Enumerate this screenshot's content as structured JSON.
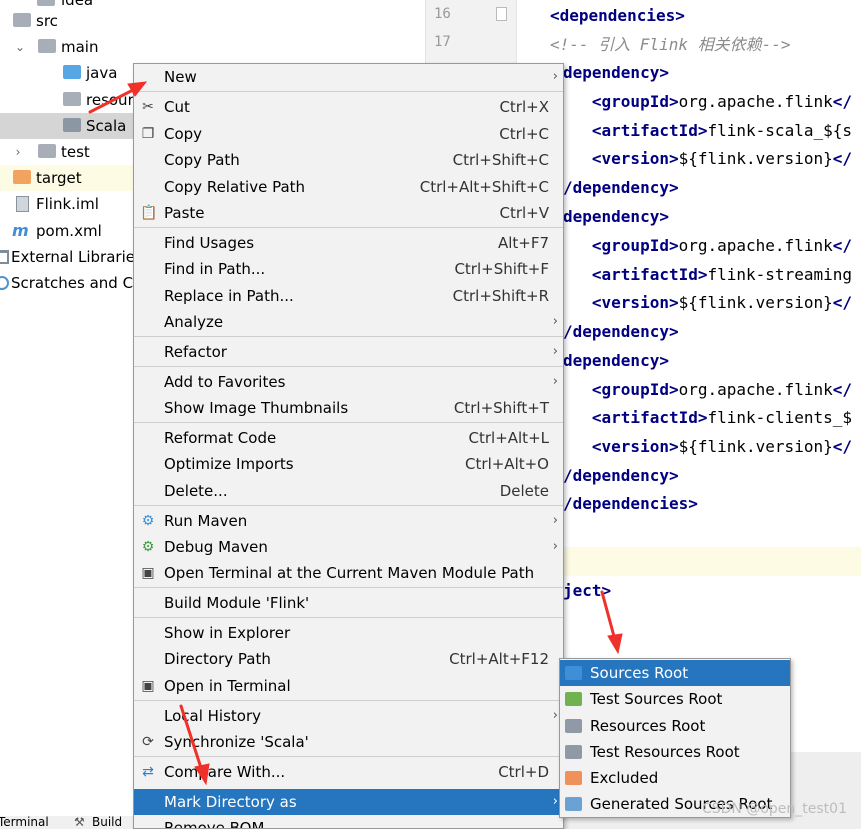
{
  "tree": {
    "items": [
      {
        "label": "idea",
        "type": "folder"
      },
      {
        "label": "src",
        "type": "folder"
      },
      {
        "label": "main",
        "type": "folder"
      },
      {
        "label": "java",
        "type": "folder-blue"
      },
      {
        "label": "resour",
        "type": "folder-res"
      },
      {
        "label": "Scala",
        "type": "folder-scala"
      },
      {
        "label": "test",
        "type": "folder"
      },
      {
        "label": "target",
        "type": "folder-orange"
      },
      {
        "label": "Flink.iml",
        "type": "file"
      },
      {
        "label": "pom.xml",
        "type": "maven-file"
      },
      {
        "label": "External Libraries",
        "type": "library"
      },
      {
        "label": "Scratches and Co",
        "type": "scratches"
      }
    ],
    "tool_tabs": [
      "Terminal",
      "Build"
    ]
  },
  "editor": {
    "line_numbers": [
      "16",
      "17"
    ],
    "lines": [
      {
        "parts": [
          {
            "t": "<dependencies>",
            "c": "tag"
          }
        ]
      },
      {
        "parts": [
          {
            "t": "<!-- 引入 Flink 相关依赖-->",
            "c": "cmt"
          }
        ]
      },
      {
        "parts": [
          {
            "t": "dependency>",
            "c": "tag"
          }
        ]
      },
      {
        "parts": [
          {
            "t": "   <groupId>",
            "c": "tag"
          },
          {
            "t": "org.apache.flink",
            "c": "val"
          },
          {
            "t": "</",
            "c": "tag"
          }
        ]
      },
      {
        "parts": [
          {
            "t": "   <artifactId>",
            "c": "tag"
          },
          {
            "t": "flink-scala_${s",
            "c": "val"
          }
        ]
      },
      {
        "parts": [
          {
            "t": "   <version>",
            "c": "tag"
          },
          {
            "t": "${flink.version}",
            "c": "val"
          },
          {
            "t": "</",
            "c": "tag"
          }
        ]
      },
      {
        "parts": [
          {
            "t": "/dependency>",
            "c": "tag"
          }
        ]
      },
      {
        "parts": [
          {
            "t": "dependency>",
            "c": "tag"
          }
        ]
      },
      {
        "parts": [
          {
            "t": "   <groupId>",
            "c": "tag"
          },
          {
            "t": "org.apache.flink",
            "c": "val"
          },
          {
            "t": "</",
            "c": "tag"
          }
        ]
      },
      {
        "parts": [
          {
            "t": "   <artifactId>",
            "c": "tag"
          },
          {
            "t": "flink-streaming",
            "c": "val"
          }
        ]
      },
      {
        "parts": [
          {
            "t": "   <version>",
            "c": "tag"
          },
          {
            "t": "${flink.version}",
            "c": "val"
          },
          {
            "t": "</",
            "c": "tag"
          }
        ]
      },
      {
        "parts": [
          {
            "t": "/dependency>",
            "c": "tag"
          }
        ]
      },
      {
        "parts": [
          {
            "t": "dependency>",
            "c": "tag"
          }
        ]
      },
      {
        "parts": [
          {
            "t": "   <groupId>",
            "c": "tag"
          },
          {
            "t": "org.apache.flink",
            "c": "val"
          },
          {
            "t": "</",
            "c": "tag"
          }
        ]
      },
      {
        "parts": [
          {
            "t": "   <artifactId>",
            "c": "tag"
          },
          {
            "t": "flink-clients_$",
            "c": "val"
          }
        ]
      },
      {
        "parts": [
          {
            "t": "   <version>",
            "c": "tag"
          },
          {
            "t": "${flink.version}",
            "c": "val"
          },
          {
            "t": "</",
            "c": "tag"
          }
        ]
      },
      {
        "parts": [
          {
            "t": "/dependency>",
            "c": "tag"
          }
        ]
      },
      {
        "parts": [
          {
            "t": "/dependencies>",
            "c": "tag"
          }
        ]
      },
      {
        "parts": []
      },
      {
        "parts": []
      },
      {
        "parts": [
          {
            "t": "ject>",
            "c": "tag"
          }
        ]
      }
    ]
  },
  "context_menu": {
    "items": [
      {
        "label": "New",
        "submenu": true
      },
      {
        "label": "Cut",
        "shortcut": "Ctrl+X",
        "icon": "cut-icon",
        "glyph": "✂",
        "sep_before": true
      },
      {
        "label": "Copy",
        "shortcut": "Ctrl+C",
        "icon": "copy-icon",
        "glyph": "❐"
      },
      {
        "label": "Copy Path",
        "shortcut": "Ctrl+Shift+C"
      },
      {
        "label": "Copy Relative Path",
        "shortcut": "Ctrl+Alt+Shift+C"
      },
      {
        "label": "Paste",
        "shortcut": "Ctrl+V",
        "icon": "paste-icon",
        "glyph": "📋"
      },
      {
        "label": "Find Usages",
        "shortcut": "Alt+F7",
        "sep_before": true
      },
      {
        "label": "Find in Path...",
        "shortcut": "Ctrl+Shift+F"
      },
      {
        "label": "Replace in Path...",
        "shortcut": "Ctrl+Shift+R"
      },
      {
        "label": "Analyze",
        "submenu": true
      },
      {
        "label": "Refactor",
        "submenu": true,
        "sep_before": true
      },
      {
        "label": "Add to Favorites",
        "submenu": true,
        "sep_before": true
      },
      {
        "label": "Show Image Thumbnails",
        "shortcut": "Ctrl+Shift+T"
      },
      {
        "label": "Reformat Code",
        "shortcut": "Ctrl+Alt+L",
        "sep_before": true
      },
      {
        "label": "Optimize Imports",
        "shortcut": "Ctrl+Alt+O"
      },
      {
        "label": "Delete...",
        "shortcut": "Delete"
      },
      {
        "label": "Run Maven",
        "submenu": true,
        "icon": "maven-run-icon",
        "glyph": "⚙",
        "sep_before": true
      },
      {
        "label": "Debug Maven",
        "submenu": true,
        "icon": "maven-debug-icon",
        "glyph": "⚙"
      },
      {
        "label": "Open Terminal at the Current Maven Module Path",
        "icon": "terminal-icon",
        "glyph": "▣"
      },
      {
        "label": "Build Module 'Flink'",
        "sep_before": true
      },
      {
        "label": "Show in Explorer",
        "sep_before": true
      },
      {
        "label": "Directory Path",
        "shortcut": "Ctrl+Alt+F12"
      },
      {
        "label": "Open in Terminal",
        "icon": "terminal-icon",
        "glyph": "▣"
      },
      {
        "label": "Local History",
        "submenu": true,
        "sep_before": true
      },
      {
        "label": "Synchronize 'Scala'",
        "icon": "sync-icon",
        "glyph": "⟳"
      },
      {
        "label": "Compare With...",
        "shortcut": "Ctrl+D",
        "icon": "compare-icon",
        "glyph": "⇄",
        "sep_before": true
      },
      {
        "label": "Mark Directory as",
        "submenu": true,
        "active": true
      },
      {
        "label": "Remove BOM"
      }
    ]
  },
  "submenu": {
    "items": [
      {
        "label": "Sources Root",
        "color": "#3d8fd6",
        "active": true
      },
      {
        "label": "Test Sources Root",
        "color": "#6fb24f"
      },
      {
        "label": "Resources Root",
        "color": "#8f9aa6"
      },
      {
        "label": "Test Resources Root",
        "color": "#8f9aa6"
      },
      {
        "label": "Excluded",
        "color": "#f0905a"
      },
      {
        "label": "Generated Sources Root",
        "color": "#6aa2d3"
      }
    ]
  },
  "watermark": "CSDN @open_test01",
  "colors": {
    "selection": "#2675bf",
    "annotation_arrow": "#f0302a"
  }
}
